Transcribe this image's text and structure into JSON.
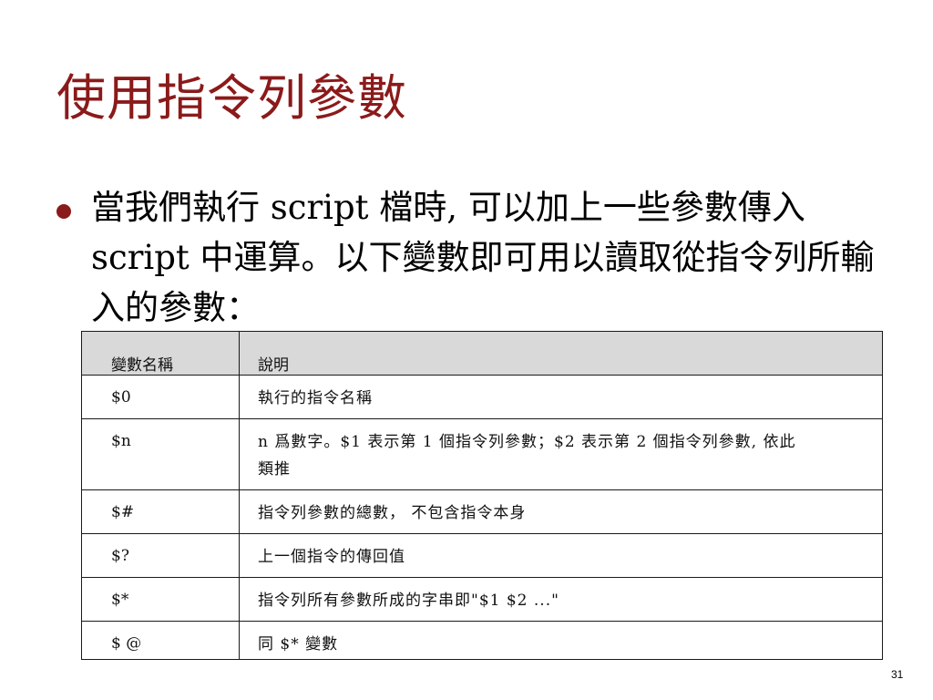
{
  "slide": {
    "title": "使用指令列參數",
    "bullet_text": "當我們執行 script 檔時, 可以加上一些參數傳入 script 中運算。以下變數即可用以讀取從指令列所輸入的參數：",
    "page_number": "31"
  },
  "table": {
    "headers": [
      "變數名稱",
      "說明"
    ],
    "rows": [
      {
        "name": "$0",
        "desc": "執行的指令名稱"
      },
      {
        "name": "$n",
        "desc": "n 爲數字。$1 表示第 1 個指令列參數；$2 表示第 2 個指令列參數, 依此類推"
      },
      {
        "name": "$#",
        "desc": "指令列參數的總數， 不包含指令本身"
      },
      {
        "name": "$?",
        "desc": "上一個指令的傳回值"
      },
      {
        "name": "$*",
        "desc": "指令列所有參數所成的字串即\"$1 $2 ...\""
      },
      {
        "name": "$ @",
        "desc": "同 $* 變數"
      }
    ]
  },
  "colors": {
    "title": "#8b1a1a",
    "bullet_dot": "#8b1a1a",
    "header_bg": "#d9d9d9"
  }
}
